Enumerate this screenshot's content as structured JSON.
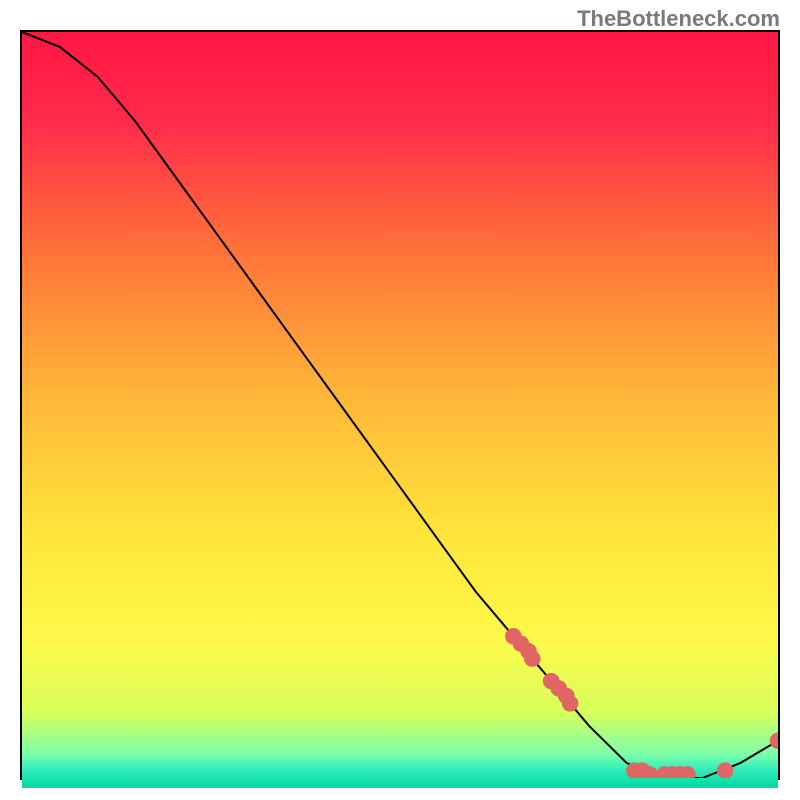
{
  "watermark": "TheBottleneck.com",
  "chart_data": {
    "type": "line",
    "title": "",
    "xlabel": "",
    "ylabel": "",
    "xlim": [
      0,
      100
    ],
    "ylim": [
      0,
      100
    ],
    "grid": false,
    "series": [
      {
        "name": "bottleneck-curve",
        "x": [
          0,
          5,
          10,
          15,
          20,
          25,
          30,
          35,
          40,
          45,
          50,
          55,
          60,
          65,
          70,
          75,
          80,
          85,
          90,
          95,
          100
        ],
        "y": [
          100,
          98,
          94,
          88,
          81,
          74,
          67,
          60,
          53,
          46,
          39,
          32,
          25,
          19,
          13,
          7,
          2,
          0,
          0,
          2,
          5
        ]
      }
    ],
    "scatter_points": {
      "name": "highlighted-points",
      "color": "#e06666",
      "points": [
        {
          "x": 65,
          "y": 19
        },
        {
          "x": 66,
          "y": 18
        },
        {
          "x": 67,
          "y": 17
        },
        {
          "x": 67.5,
          "y": 16
        },
        {
          "x": 70,
          "y": 13
        },
        {
          "x": 71,
          "y": 12
        },
        {
          "x": 72,
          "y": 11
        },
        {
          "x": 72.5,
          "y": 10
        },
        {
          "x": 81,
          "y": 1
        },
        {
          "x": 82,
          "y": 1
        },
        {
          "x": 83,
          "y": 0.5
        },
        {
          "x": 85,
          "y": 0.5
        },
        {
          "x": 86,
          "y": 0.5
        },
        {
          "x": 87,
          "y": 0.5
        },
        {
          "x": 88,
          "y": 0.5
        },
        {
          "x": 93,
          "y": 1
        },
        {
          "x": 100,
          "y": 5
        }
      ]
    },
    "background_gradient": {
      "type": "vertical",
      "stops": [
        {
          "pos": 0.0,
          "color": "#ff1744"
        },
        {
          "pos": 0.12,
          "color": "#ff2b4a"
        },
        {
          "pos": 0.28,
          "color": "#ff6f3a"
        },
        {
          "pos": 0.48,
          "color": "#ffb63a"
        },
        {
          "pos": 0.66,
          "color": "#ffe43a"
        },
        {
          "pos": 0.8,
          "color": "#fff94a"
        },
        {
          "pos": 0.9,
          "color": "#d7ff5a"
        },
        {
          "pos": 0.955,
          "color": "#7dffaa"
        },
        {
          "pos": 0.975,
          "color": "#33eebb"
        },
        {
          "pos": 1.0,
          "color": "#00d8a0"
        }
      ]
    }
  }
}
